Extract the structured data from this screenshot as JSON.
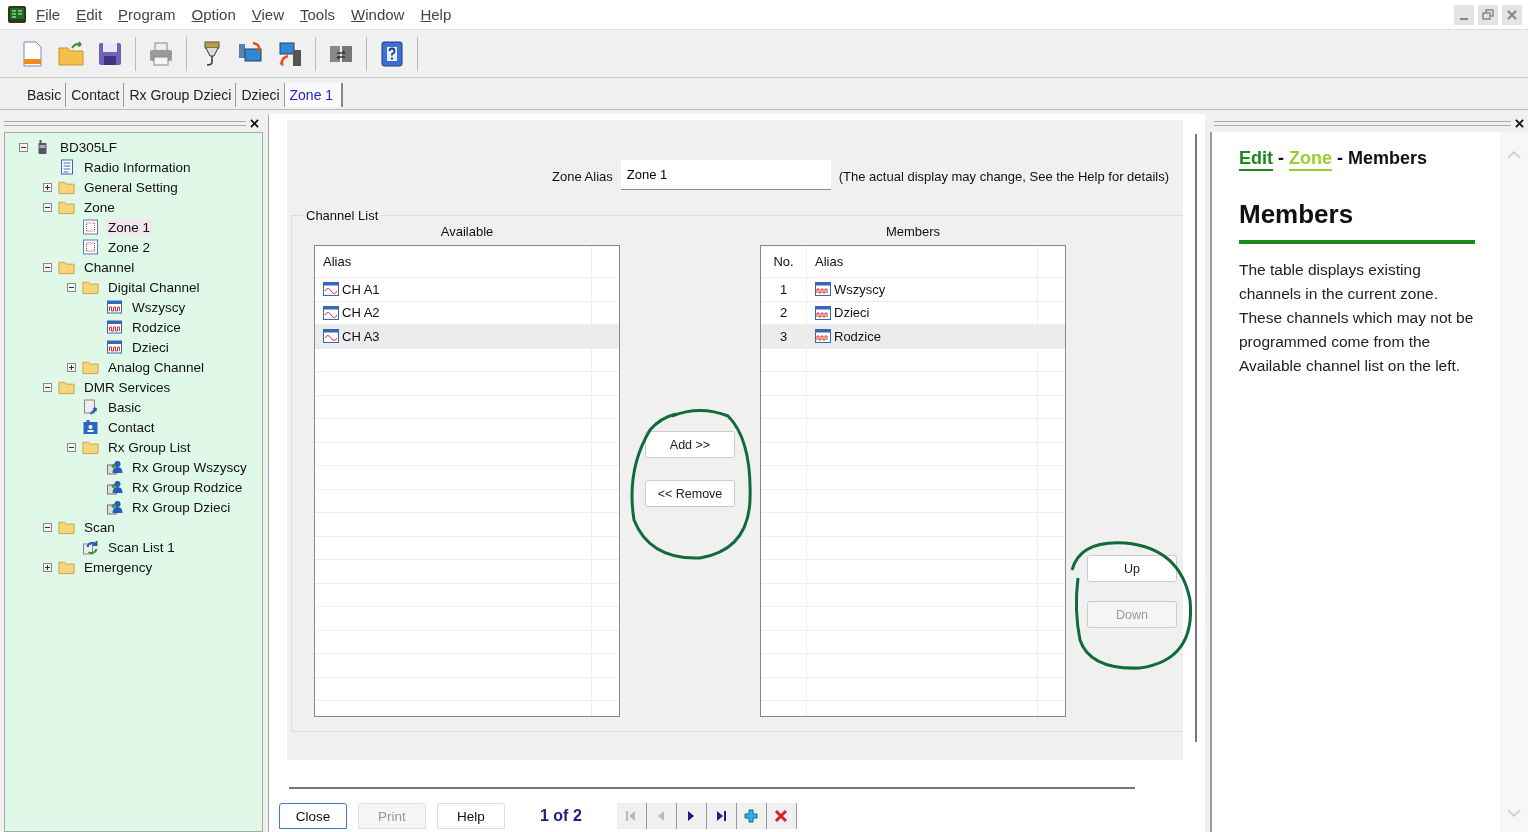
{
  "menu": [
    "File",
    "Edit",
    "Program",
    "Option",
    "View",
    "Tools",
    "Window",
    "Help"
  ],
  "tabs": [
    {
      "label": "Basic",
      "selected": false
    },
    {
      "label": "Contact",
      "selected": false
    },
    {
      "label": "Rx Group Dzieci",
      "selected": false
    },
    {
      "label": "Dzieci",
      "selected": false
    },
    {
      "label": "Zone 1",
      "selected": true
    }
  ],
  "tree": [
    {
      "label": "BD305LF",
      "kind": "device",
      "expanded": true,
      "selected": false,
      "children": [
        {
          "label": "Radio Information",
          "kind": "info",
          "selected": false
        },
        {
          "label": "General Setting",
          "kind": "folder",
          "expanded": false,
          "selected": false
        },
        {
          "label": "Zone",
          "kind": "folder",
          "expanded": true,
          "selected": false,
          "children": [
            {
              "label": "Zone 1",
              "kind": "zone",
              "selected": true
            },
            {
              "label": "Zone 2",
              "kind": "zone",
              "selected": false
            }
          ]
        },
        {
          "label": "Channel",
          "kind": "folder",
          "expanded": true,
          "selected": false,
          "children": [
            {
              "label": "Digital Channel",
              "kind": "folder",
              "expanded": true,
              "selected": false,
              "children": [
                {
                  "label": "Wszyscy",
                  "kind": "digital",
                  "selected": false
                },
                {
                  "label": "Rodzice",
                  "kind": "digital",
                  "selected": false
                },
                {
                  "label": "Dzieci",
                  "kind": "digital",
                  "selected": false
                }
              ]
            },
            {
              "label": "Analog Channel",
              "kind": "folder",
              "expanded": false,
              "selected": false
            }
          ]
        },
        {
          "label": "DMR Services",
          "kind": "folder",
          "expanded": true,
          "selected": false,
          "children": [
            {
              "label": "Basic",
              "kind": "basic",
              "selected": false
            },
            {
              "label": "Contact",
              "kind": "contact",
              "selected": false
            },
            {
              "label": "Rx Group List",
              "kind": "folder",
              "expanded": true,
              "selected": false,
              "children": [
                {
                  "label": "Rx Group Wszyscy",
                  "kind": "group",
                  "selected": false
                },
                {
                  "label": "Rx Group Rodzice",
                  "kind": "group",
                  "selected": false
                },
                {
                  "label": "Rx Group Dzieci",
                  "kind": "group",
                  "selected": false
                }
              ]
            }
          ]
        },
        {
          "label": "Scan",
          "kind": "folder",
          "expanded": true,
          "selected": false,
          "children": [
            {
              "label": "Scan List 1",
              "kind": "scan",
              "selected": false
            }
          ]
        },
        {
          "label": "Emergency",
          "kind": "folder",
          "expanded": false,
          "selected": false
        }
      ]
    }
  ],
  "zone_alias": {
    "label": "Zone Alias",
    "value": "Zone 1",
    "note": "(The actual display may change, See the Help for details)"
  },
  "channel_list": {
    "title": "Channel List",
    "available": {
      "title": "Available",
      "columns": [
        "Alias"
      ],
      "rows": [
        {
          "alias": "CH A1",
          "kind": "analog",
          "selected": false
        },
        {
          "alias": "CH A2",
          "kind": "analog",
          "selected": false
        },
        {
          "alias": "CH A3",
          "kind": "analog",
          "selected": true
        }
      ]
    },
    "members": {
      "title": "Members",
      "columns": [
        "No.",
        "Alias"
      ],
      "rows": [
        {
          "no": "1",
          "alias": "Wszyscy",
          "kind": "digital",
          "selected": false
        },
        {
          "no": "2",
          "alias": "Dzieci",
          "kind": "digital",
          "selected": false
        },
        {
          "no": "3",
          "alias": "Rodzice",
          "kind": "digital",
          "selected": true
        }
      ]
    },
    "add_button": {
      "label": "Add >>",
      "disabled": false
    },
    "remove_button": {
      "label": "<< Remove",
      "disabled": false
    },
    "up_button": {
      "label": "Up",
      "disabled": false
    },
    "down_button": {
      "label": "Down",
      "disabled": true
    }
  },
  "bottom": {
    "buttons": [
      {
        "label": "Close",
        "disabled": false,
        "focused": true
      },
      {
        "label": "Print",
        "disabled": true,
        "focused": false
      },
      {
        "label": "Help",
        "disabled": false,
        "focused": false
      }
    ],
    "page": "1 of 2",
    "nav": [
      {
        "kind": "first",
        "disabled": true
      },
      {
        "kind": "prev",
        "disabled": true
      },
      {
        "kind": "next",
        "disabled": false
      },
      {
        "kind": "last",
        "disabled": false
      },
      {
        "kind": "add",
        "disabled": false
      },
      {
        "kind": "delete",
        "disabled": false
      }
    ]
  },
  "help": {
    "separator": "-",
    "breadcrumb": [
      {
        "label": "Edit",
        "kind": "link",
        "color": "#1a8a1a"
      },
      {
        "label": "Zone",
        "kind": "link",
        "color": "#9acd32"
      },
      {
        "label": "Members",
        "kind": "current",
        "color": "#111111"
      }
    ],
    "heading": "Members",
    "text": "The table displays existing channels in the current zone. These channels which may not be programmed come from the Available channel list on the left."
  }
}
